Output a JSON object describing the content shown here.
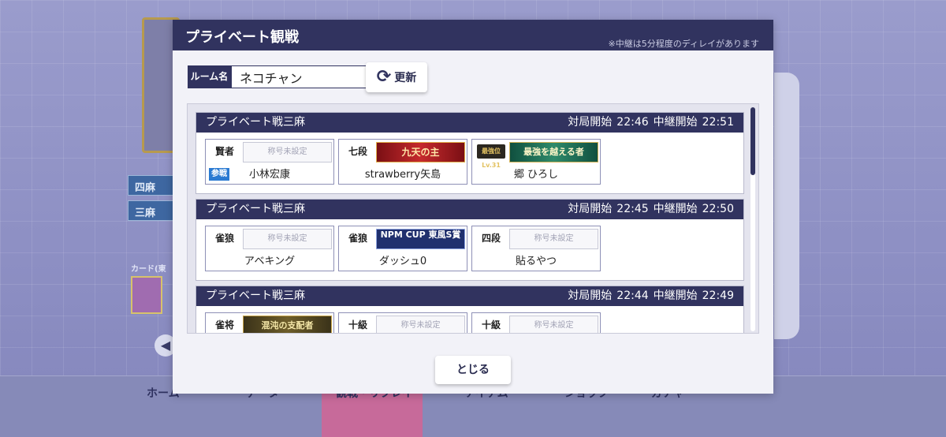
{
  "background": {
    "modes": [
      "四麻",
      "三麻"
    ],
    "card_label": "カード(東",
    "nav": [
      {
        "label": "ホーム",
        "icon": "home-icon"
      },
      {
        "label": "データ",
        "icon": "data-icon"
      },
      {
        "label": "観戦・リプレイ",
        "icon": "watch-icon"
      },
      {
        "label": "アイテム",
        "icon": "item-icon"
      },
      {
        "label": "ショップ",
        "icon": "shop-icon"
      },
      {
        "label": "ガチャ",
        "icon": "gacha-icon"
      }
    ]
  },
  "dialog": {
    "title": "プライベート観戦",
    "note": "※中継は5分程度のディレイがあります",
    "room_label": "ルーム名",
    "room_value": "ネコチャン",
    "refresh_label": "更新",
    "close_label": "とじる",
    "start_label": "対局開始",
    "relay_label": "中継開始"
  },
  "matches": [
    {
      "title": "プライベート戦三麻",
      "start": "22:46",
      "relay": "22:51",
      "players": [
        {
          "rank": "賢者",
          "title": "称号未設定",
          "name": "小林宏康",
          "badge": "参戦"
        },
        {
          "rank": "七段",
          "title": "九天の主",
          "name": "strawberry矢島",
          "badge": ""
        },
        {
          "rank": "最強位Lv.31",
          "title": "最強を越える者",
          "name": "郷 ひろし",
          "badge": ""
        }
      ]
    },
    {
      "title": "プライベート戦三麻",
      "start": "22:45",
      "relay": "22:50",
      "players": [
        {
          "rank": "雀狼",
          "title": "称号未設定",
          "name": "アベキング",
          "badge": ""
        },
        {
          "rank": "雀狼",
          "title": "NPM CUP 東風S賞",
          "name": "ダッシュ0",
          "badge": ""
        },
        {
          "rank": "四段",
          "title": "称号未設定",
          "name": "貼るやつ",
          "badge": ""
        }
      ]
    },
    {
      "title": "プライベート戦三麻",
      "start": "22:44",
      "relay": "22:49",
      "players": [
        {
          "rank": "雀将",
          "title": "混沌の支配者",
          "name": "",
          "badge": ""
        },
        {
          "rank": "十級",
          "title": "称号未設定",
          "name": "",
          "badge": ""
        },
        {
          "rank": "十級",
          "title": "称号未設定",
          "name": "",
          "badge": ""
        }
      ]
    }
  ],
  "colors": {
    "header": "#31335f",
    "badge": "#2a7ad2"
  }
}
